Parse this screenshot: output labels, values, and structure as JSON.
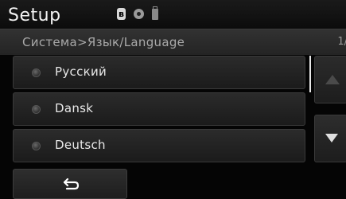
{
  "header": {
    "title": "Setup",
    "status_icons": [
      "bluetooth-icon",
      "disc-icon",
      "usb-icon"
    ]
  },
  "breadcrumb": {
    "path": "Система>Язык/Language",
    "page": "1/"
  },
  "languages": [
    {
      "label": "Русский"
    },
    {
      "label": "Dansk"
    },
    {
      "label": "Deutsch"
    }
  ],
  "scroll": {
    "up_icon": "arrow-up-icon",
    "down_icon": "arrow-down-icon"
  },
  "footer": {
    "back_icon": "back-arrow-icon"
  },
  "colors": {
    "background": "#050505",
    "text": "#e9e9e9",
    "muted_text": "#a9a9a9"
  }
}
